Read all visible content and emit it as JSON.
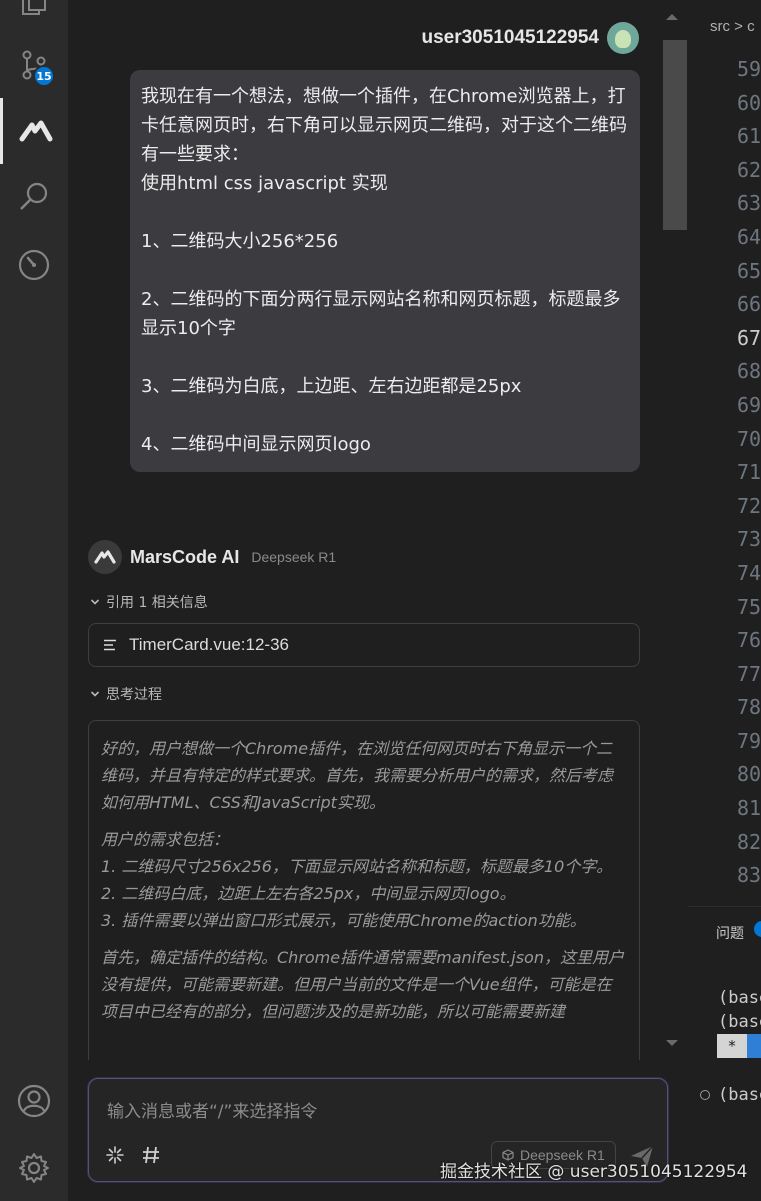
{
  "activity_bar": {
    "source_control_badge": "15"
  },
  "chat": {
    "user": {
      "name": "user3051045122954"
    },
    "user_message": {
      "paragraphs": [
        "我现在有一个想法，想做一个插件，在Chrome浏览器上，打卡任意网页时，右下角可以显示网页二维码，对于这个二维码有一些要求：\n使用html css javascript 实现",
        "1、二维码大小256*256",
        "2、二维码的下面分两行显示网站名称和网页标题，标题最多显示10个字",
        "3、二维码为白底，上边距、左右边距都是25px",
        "4、二维码中间显示网页logo"
      ]
    },
    "assistant": {
      "name": "MarsCode AI",
      "model": "Deepseek R1",
      "references_label": "引用 1 相关信息",
      "reference_file": "TimerCard.vue:12-36",
      "thinking_label": "思考过程",
      "thinking_paragraphs": [
        "好的，用户想做一个Chrome插件，在浏览任何网页时右下角显示一个二维码，并且有特定的样式要求。首先，我需要分析用户的需求，然后考虑如何用HTML、CSS和JavaScript实现。",
        "用户的需求包括：\n1. 二维码尺寸256x256，下面显示网站名称和标题，标题最多10个字。\n2. 二维码白底，边距上左右各25px，中间显示网页logo。\n3. 插件需要以弹出窗口形式展示，可能使用Chrome的action功能。",
        "首先，确定插件的结构。Chrome插件通常需要manifest.json，这里用户没有提供，可能需要新建。但用户当前的文件是一个Vue组件，可能是在项目中已经有的部分，但问题涉及的是新功能，所以可能需要新建"
      ]
    },
    "input": {
      "placeholder": "输入消息或者“/”来选择指令",
      "model_chip": "Deepseek R1"
    }
  },
  "editor": {
    "breadcrumb": "src > c",
    "line_numbers": [
      "59",
      "60",
      "61",
      "62",
      "63",
      "64",
      "65",
      "66",
      "67",
      "68",
      "69",
      "70",
      "71",
      "72",
      "73",
      "74",
      "75",
      "76",
      "77",
      "78",
      "79",
      "80",
      "81",
      "82",
      "83"
    ],
    "current_line": "67",
    "panel_tab": "问题",
    "terminal_lines": [
      "(base",
      "(base",
      "(base"
    ],
    "terminal_highlight": "*"
  },
  "watermark": "掘金技术社区 @ user3051045122954"
}
